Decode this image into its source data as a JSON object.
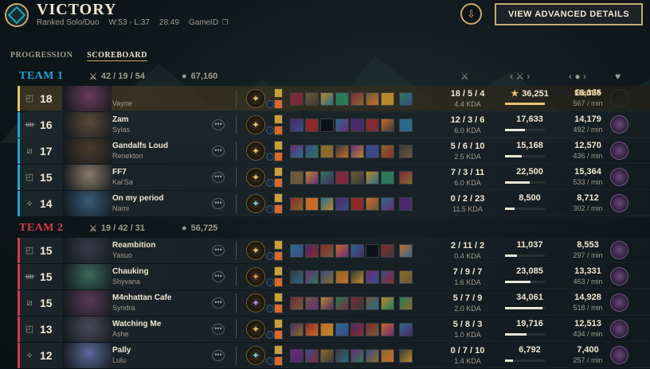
{
  "header": {
    "result": "VICTORY",
    "queue": "Ranked Solo/Duo",
    "record": "W:53 - L:37",
    "duration": "28:49",
    "game_id_label": "GameID",
    "advanced_button": "VIEW ADVANCED DETAILS"
  },
  "tabs": [
    {
      "label": "PROGRESSION",
      "active": false
    },
    {
      "label": "SCOREBOARD",
      "active": true
    }
  ],
  "teams": [
    {
      "name": "TEAM 1",
      "color": "#1fa3d8",
      "kda": "42 / 19 / 54",
      "gold": "67,160",
      "players": [
        {
          "role": "top-icon",
          "level": "18",
          "summoner": "Gemie",
          "champion": "Vayne",
          "kda": "18 / 5 / 4",
          "kda_ratio": "4.4 KDA",
          "damage": "36,251",
          "damage_pct": 1.0,
          "star": "★",
          "gold": "16,335",
          "gpm": "567 / min",
          "highlight": true,
          "champ_color": "#6a3a5a",
          "rune_color": "#e8c46a",
          "badge": false
        },
        {
          "role": "jungle-icon",
          "level": "16",
          "summoner": "Zam",
          "champion": "Sylas",
          "kda": "12 / 3 / 6",
          "kda_ratio": "6.0 KDA",
          "damage": "17,633",
          "damage_pct": 0.49,
          "gold": "14,179",
          "gpm": "492 / min",
          "highlight": false,
          "champ_color": "#5a4a3a",
          "rune_color": "#e8c46a",
          "badge": true
        },
        {
          "role": "middle-icon",
          "level": "17",
          "summoner": "Gandalfs Loud",
          "champion": "Renekton",
          "kda": "5 / 6 / 10",
          "kda_ratio": "2.5 KDA",
          "damage": "15,168",
          "damage_pct": 0.42,
          "gold": "12,570",
          "gpm": "436 / min",
          "highlight": false,
          "champ_color": "#4a3a2a",
          "rune_color": "#e8c46a",
          "badge": true
        },
        {
          "role": "top-icon",
          "level": "15",
          "summoner": "FF7",
          "champion": "Kai'Sa",
          "kda": "7 / 3 / 11",
          "kda_ratio": "6.0 KDA",
          "damage": "22,500",
          "damage_pct": 0.62,
          "gold": "15,364",
          "gpm": "533 / min",
          "highlight": false,
          "champ_color": "#8a7a6a",
          "rune_color": "#e8c46a",
          "badge": true
        },
        {
          "role": "support-icon",
          "level": "14",
          "summoner": "On my period",
          "champion": "Nami",
          "kda": "0 / 2 / 23",
          "kda_ratio": "11.5 KDA",
          "damage": "8,500",
          "damage_pct": 0.23,
          "gold": "8,712",
          "gpm": "302 / min",
          "highlight": false,
          "champ_color": "#3a5a7a",
          "rune_color": "#7ac8e8",
          "badge": true
        }
      ]
    },
    {
      "name": "TEAM 2",
      "color": "#d83a4a",
      "kda": "19 / 42 / 31",
      "gold": "56,725",
      "players": [
        {
          "role": "top-icon",
          "level": "15",
          "summoner": "Reambition",
          "champion": "Yasuo",
          "kda": "2 / 11 / 2",
          "kda_ratio": "0.4 KDA",
          "damage": "11,037",
          "damage_pct": 0.3,
          "gold": "8,553",
          "gpm": "297 / min",
          "highlight": false,
          "champ_color": "#3a3a4a",
          "rune_color": "#e8c46a",
          "badge": true
        },
        {
          "role": "jungle-icon",
          "level": "15",
          "summoner": "Chauking",
          "champion": "Shyvana",
          "kda": "7 / 9 / 7",
          "kda_ratio": "1.6 KDA",
          "damage": "23,085",
          "damage_pct": 0.64,
          "gold": "13,331",
          "gpm": "463 / min",
          "highlight": false,
          "champ_color": "#3a6a5a",
          "rune_color": "#e89a4a",
          "badge": true
        },
        {
          "role": "middle-icon",
          "level": "15",
          "summoner": "M4nhattan Cafe",
          "champion": "Syndra",
          "kda": "5 / 7 / 9",
          "kda_ratio": "2.0 KDA",
          "damage": "34,061",
          "damage_pct": 0.94,
          "gold": "14,928",
          "gpm": "518 / min",
          "highlight": false,
          "champ_color": "#5a3a5a",
          "rune_color": "#b88ae8",
          "badge": true
        },
        {
          "role": "top-icon",
          "level": "13",
          "summoner": "Watching Me",
          "champion": "Ashe",
          "kda": "5 / 8 / 3",
          "kda_ratio": "1.0 KDA",
          "damage": "19,716",
          "damage_pct": 0.54,
          "gold": "12,513",
          "gpm": "434 / min",
          "highlight": false,
          "champ_color": "#4a4a5a",
          "rune_color": "#e8c46a",
          "badge": true
        },
        {
          "role": "support-icon",
          "level": "12",
          "summoner": "Pally",
          "champion": "Lulu",
          "kda": "0 / 7 / 10",
          "kda_ratio": "1.4 KDA",
          "damage": "6,792",
          "damage_pct": 0.19,
          "gold": "7,400",
          "gpm": "257 / min",
          "highlight": false,
          "champ_color": "#5a6a9a",
          "rune_color": "#7ac8e8",
          "badge": true
        }
      ]
    }
  ],
  "item_palette": [
    "#7a2a3a",
    "#3a4a8a",
    "#2a6a8a",
    "#6a5a3a",
    "#8a6a2a",
    "#4a2a6a",
    "#b88a2a",
    "#3a3a3a",
    "#8a2a2a",
    "#2a7a5a",
    "#6a2a7a",
    "#c86a2a"
  ]
}
